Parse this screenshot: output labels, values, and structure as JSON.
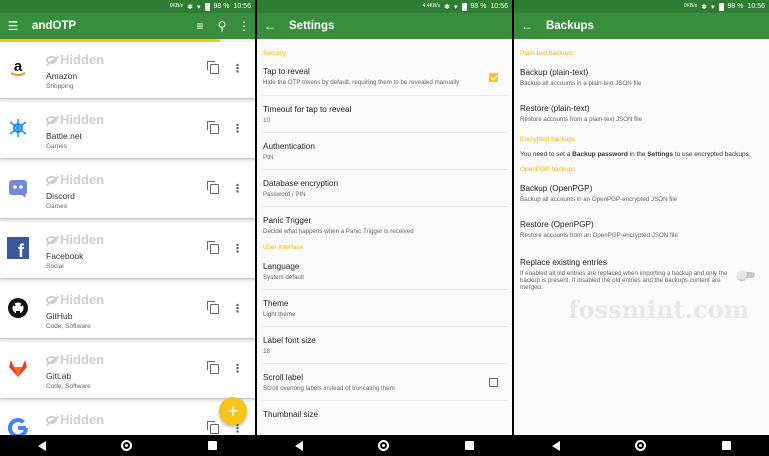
{
  "status": {
    "network1": "0KB/s",
    "network2": "4.4KB/s",
    "network3": "0KB/s",
    "battery": "98 %",
    "time": "10:56"
  },
  "accounts": {
    "title": "andOTP",
    "hidden_label": "Hidden",
    "fab_label": "+",
    "items": [
      {
        "label": "Amazon",
        "tags": "Shopping",
        "logo": "amazon-logo"
      },
      {
        "label": "Battle.net",
        "tags": "Games",
        "logo": "battlenet-logo"
      },
      {
        "label": "Discord",
        "tags": "Games",
        "logo": "discord-logo"
      },
      {
        "label": "Facebook",
        "tags": "Social",
        "logo": "facebook-logo"
      },
      {
        "label": "GitHub",
        "tags": "Code, Software",
        "logo": "github-logo"
      },
      {
        "label": "GitLab",
        "tags": "Code, Software",
        "logo": "gitlab-logo"
      },
      {
        "label": "",
        "tags": "",
        "logo": "google-logo"
      }
    ]
  },
  "settings": {
    "title": "Settings",
    "sections": {
      "security": "Security",
      "ui": "User interface"
    },
    "tap_to_reveal": {
      "title": "Tap to reveal",
      "summary": "Hide the OTP tokens by default, requiring them to be revealed manually",
      "checked": true
    },
    "timeout": {
      "title": "Timeout for tap to reveal",
      "summary": "10"
    },
    "authentication": {
      "title": "Authentication",
      "summary": "PIN"
    },
    "db_encryption": {
      "title": "Database encryption",
      "summary": "Password / PIN"
    },
    "panic": {
      "title": "Panic Trigger",
      "summary": "Decide what happens when a Panic Trigger is received"
    },
    "language": {
      "title": "Language",
      "summary": "System default"
    },
    "theme": {
      "title": "Theme",
      "summary": "Light theme"
    },
    "label_font": {
      "title": "Label font size",
      "summary": "18"
    },
    "scroll_label": {
      "title": "Scroll label",
      "summary": "Scroll overlong labels instead of truncating them",
      "checked": false
    },
    "thumbnail": {
      "title": "Thumbnail size"
    }
  },
  "backups": {
    "title": "Backups",
    "plain_header": "Plain-text backups",
    "backup_plain": {
      "title": "Backup (plain-text)",
      "summary": "Backup all accounts in a plain-text JSON file"
    },
    "restore_plain": {
      "title": "Restore (plain-text)",
      "summary": "Restore accounts from a plain-text JSON file"
    },
    "enc_header": "Encrypted backups",
    "enc_msg_1": "You need to set a ",
    "enc_msg_bold1": "Backup password",
    "enc_msg_2": " in the ",
    "enc_msg_bold2": "Settings",
    "enc_msg_3": " to use encrypted backups.",
    "pgp_header": "OpenPGP backups",
    "backup_pgp": {
      "title": "Backup (OpenPGP)",
      "summary": "Backup all accounts in an OpenPGP-encrypted JSON file"
    },
    "restore_pgp": {
      "title": "Restore (OpenPGP)",
      "summary": "Restore accounts from an OpenPGP-encrypted JSON file"
    },
    "replace": {
      "title": "Replace existing entries",
      "summary": "If enabled all old entries are replaced when importing a backup and only the backup is present. If disabled the old entries and the backups content are merged.",
      "enabled": false
    },
    "watermark": "fossmint.com"
  },
  "colors": {
    "primary": "#388e3c",
    "statusbar": "#2e7d32",
    "accent": "#f6c41a"
  }
}
